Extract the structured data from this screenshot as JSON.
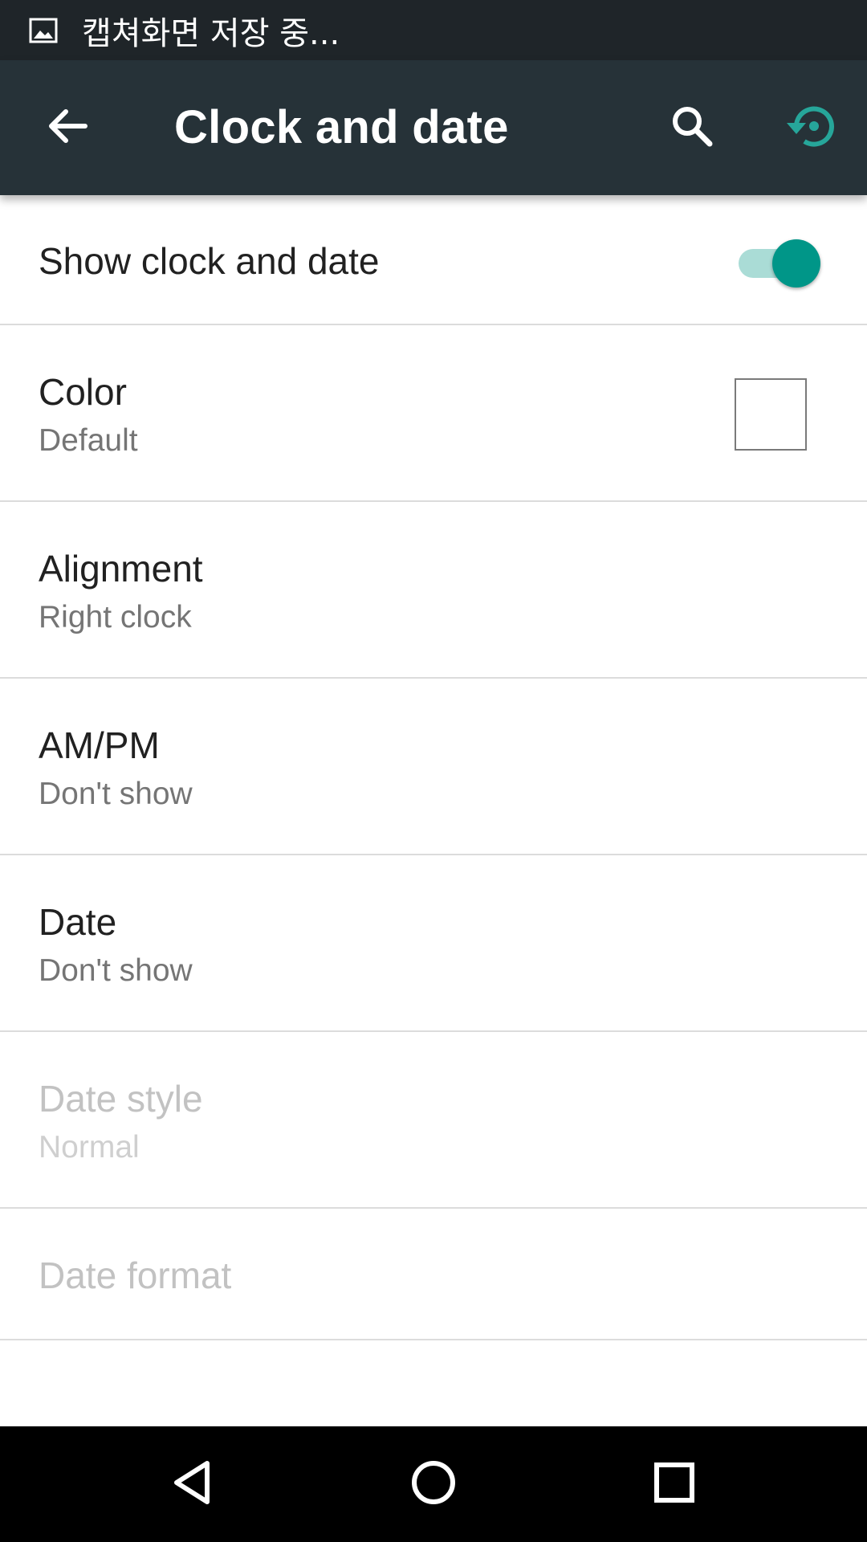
{
  "status_bar": {
    "notification_icon": "image-icon",
    "text": "캡쳐화면 저장 중..."
  },
  "toolbar": {
    "title": "Clock and date",
    "back_icon": "arrow-back-icon",
    "search_icon": "search-icon",
    "reset_icon": "restore-icon",
    "accent_color": "#26a69a"
  },
  "settings": {
    "show_clock": {
      "title": "Show clock and date",
      "enabled": true
    },
    "color": {
      "title": "Color",
      "summary": "Default"
    },
    "alignment": {
      "title": "Alignment",
      "summary": "Right clock"
    },
    "ampm": {
      "title": "AM/PM",
      "summary": "Don't show"
    },
    "date": {
      "title": "Date",
      "summary": "Don't show"
    },
    "date_style": {
      "title": "Date style",
      "summary": "Normal",
      "disabled": true
    },
    "date_format": {
      "title": "Date format",
      "disabled": true
    }
  },
  "colors": {
    "toolbar_bg": "#263238",
    "status_bar_bg": "#1f2529",
    "switch_thumb": "#009688",
    "switch_track": "#aadcd6"
  },
  "nav_bar": {
    "back_icon": "nav-back-triangle-icon",
    "home_icon": "nav-home-circle-icon",
    "recents_icon": "nav-recents-square-icon"
  }
}
